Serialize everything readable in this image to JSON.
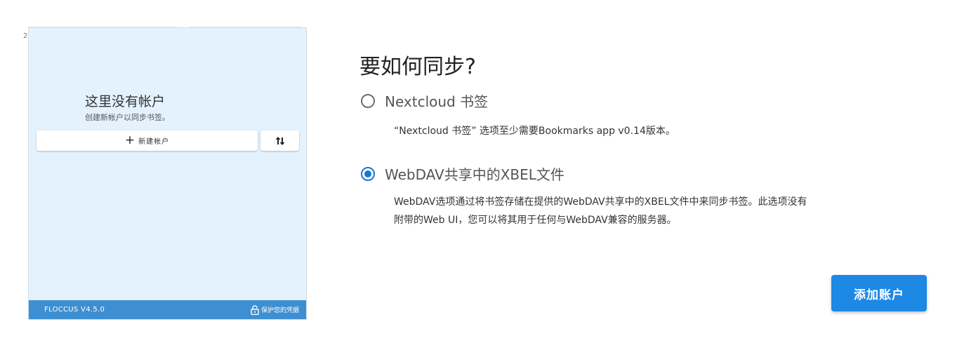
{
  "popup": {
    "edge_mark": "2",
    "empty_title": "这里没有帐户",
    "empty_subtitle": "创建新帐户以同步书签。",
    "new_account_icon": "plus-icon",
    "new_account_label": "新建帐户",
    "sort_icon": "sort-arrows-icon",
    "footer_version": "FLOCCUS V4.5.0",
    "footer_lock_icon": "lock-icon",
    "footer_secure_label": "保护您的凭据",
    "background_color": "#e3f2fd",
    "footer_color": "#3d8fd1"
  },
  "dialog": {
    "heading": "要如何同步?",
    "options": [
      {
        "label": "Nextcloud 书签",
        "description": "“Nextcloud 书签” 选项至少需要Bookmarks app v0.14版本。",
        "selected": false
      },
      {
        "label": "WebDAV共享中的XBEL文件",
        "description_line1": "WebDAV选项通过将书签存储在提供的WebDAV共享中的XBEL文件中来同步书签。此选项没有",
        "description_line2": "附带的Web UI，您可以将其用于任何与WebDAV兼容的服务器。",
        "selected": true
      }
    ],
    "add_account_label": "添加账户",
    "accent_color": "#1976d2"
  }
}
